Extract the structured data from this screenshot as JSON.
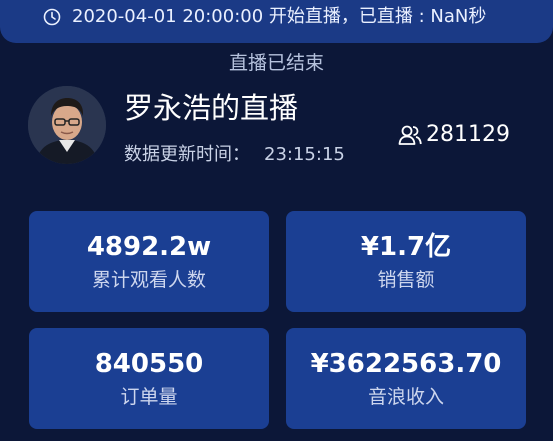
{
  "status_bar": {
    "icon": "clock-icon",
    "text": "2020-04-01 20:00:00 开始直播，已直播 : NaN秒"
  },
  "live_status": "直播已结束",
  "anchor": {
    "name": "罗永浩的直播",
    "update_label": "数据更新时间：",
    "update_time": "23:15:15",
    "viewer_icon": "viewers-icon",
    "online_count": "281129"
  },
  "stats": [
    {
      "value": "4892.2w",
      "label": "累计观看人数"
    },
    {
      "value": "¥1.7亿",
      "label": "销售额"
    },
    {
      "value": "840550",
      "label": "订单量"
    },
    {
      "value": "¥3622563.70",
      "label": "音浪收入"
    }
  ],
  "colors": {
    "background": "#0c1738",
    "bar": "#1b3a86",
    "card": "#1b3f93"
  }
}
